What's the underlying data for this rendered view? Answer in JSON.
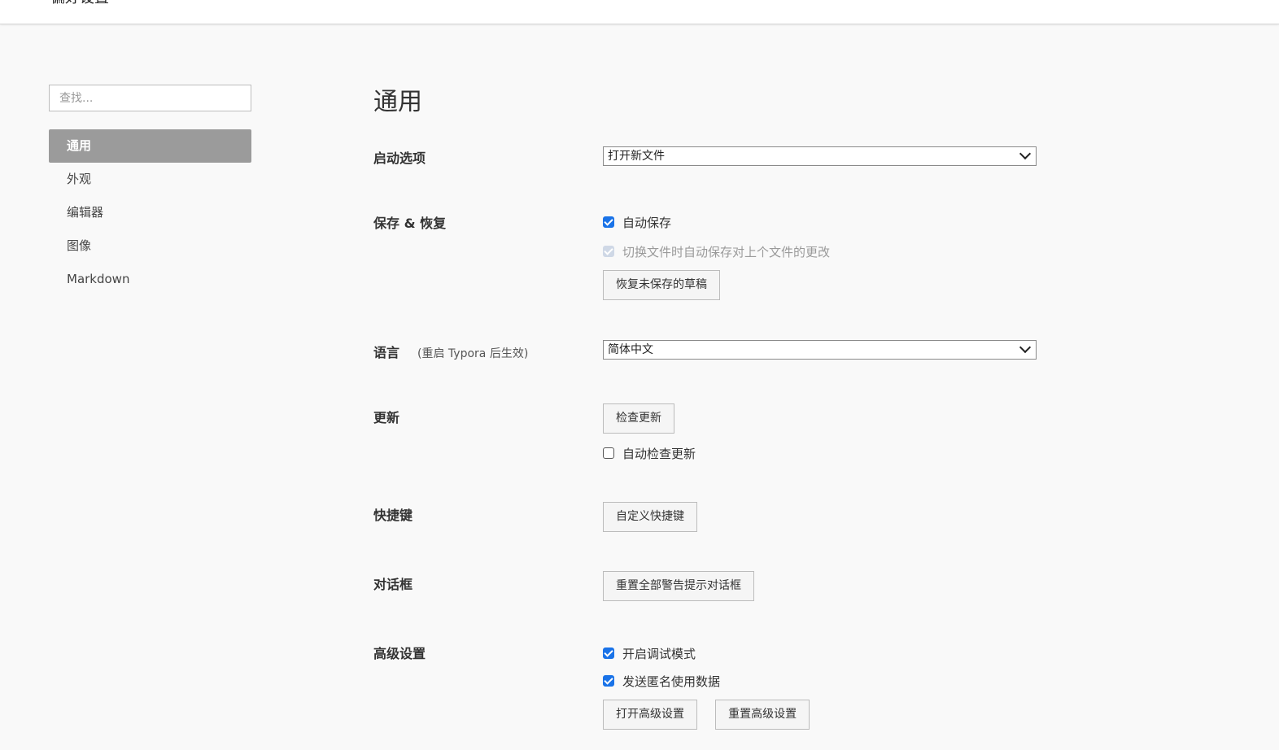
{
  "window": {
    "title": "偏好设置"
  },
  "sidebar": {
    "search_placeholder": "查找...",
    "items": [
      {
        "label": "通用",
        "active": true
      },
      {
        "label": "外观"
      },
      {
        "label": "编辑器"
      },
      {
        "label": "图像"
      },
      {
        "label": "Markdown"
      }
    ]
  },
  "main": {
    "title": "通用",
    "startup": {
      "label": "启动选项",
      "value": "打开新文件"
    },
    "save": {
      "label": "保存 & 恢复",
      "autosave": {
        "label": "自动保存",
        "checked": true
      },
      "autosave_on_switch": {
        "label": "切换文件时自动保存对上个文件的更改",
        "checked": true,
        "disabled": true
      },
      "restore_button": "恢复未保存的草稿"
    },
    "language": {
      "label": "语言",
      "note": "(重启 Typora 后生效)",
      "value": "简体中文"
    },
    "update": {
      "label": "更新",
      "check_button": "检查更新",
      "auto_check": {
        "label": "自动检查更新",
        "checked": false
      }
    },
    "shortcuts": {
      "label": "快捷键",
      "button": "自定义快捷键"
    },
    "dialogs": {
      "label": "对话框",
      "button": "重置全部警告提示对话框"
    },
    "advanced": {
      "label": "高级设置",
      "debug_mode": {
        "label": "开启调试模式",
        "checked": true
      },
      "send_usage": {
        "label": "发送匿名使用数据",
        "checked": true
      },
      "open_button": "打开高级设置",
      "reset_button": "重置高级设置"
    }
  },
  "colors": {
    "accent": "#1a73e8",
    "sidebar_active_bg": "#9b9b9b",
    "background": "#f9f9f9"
  }
}
